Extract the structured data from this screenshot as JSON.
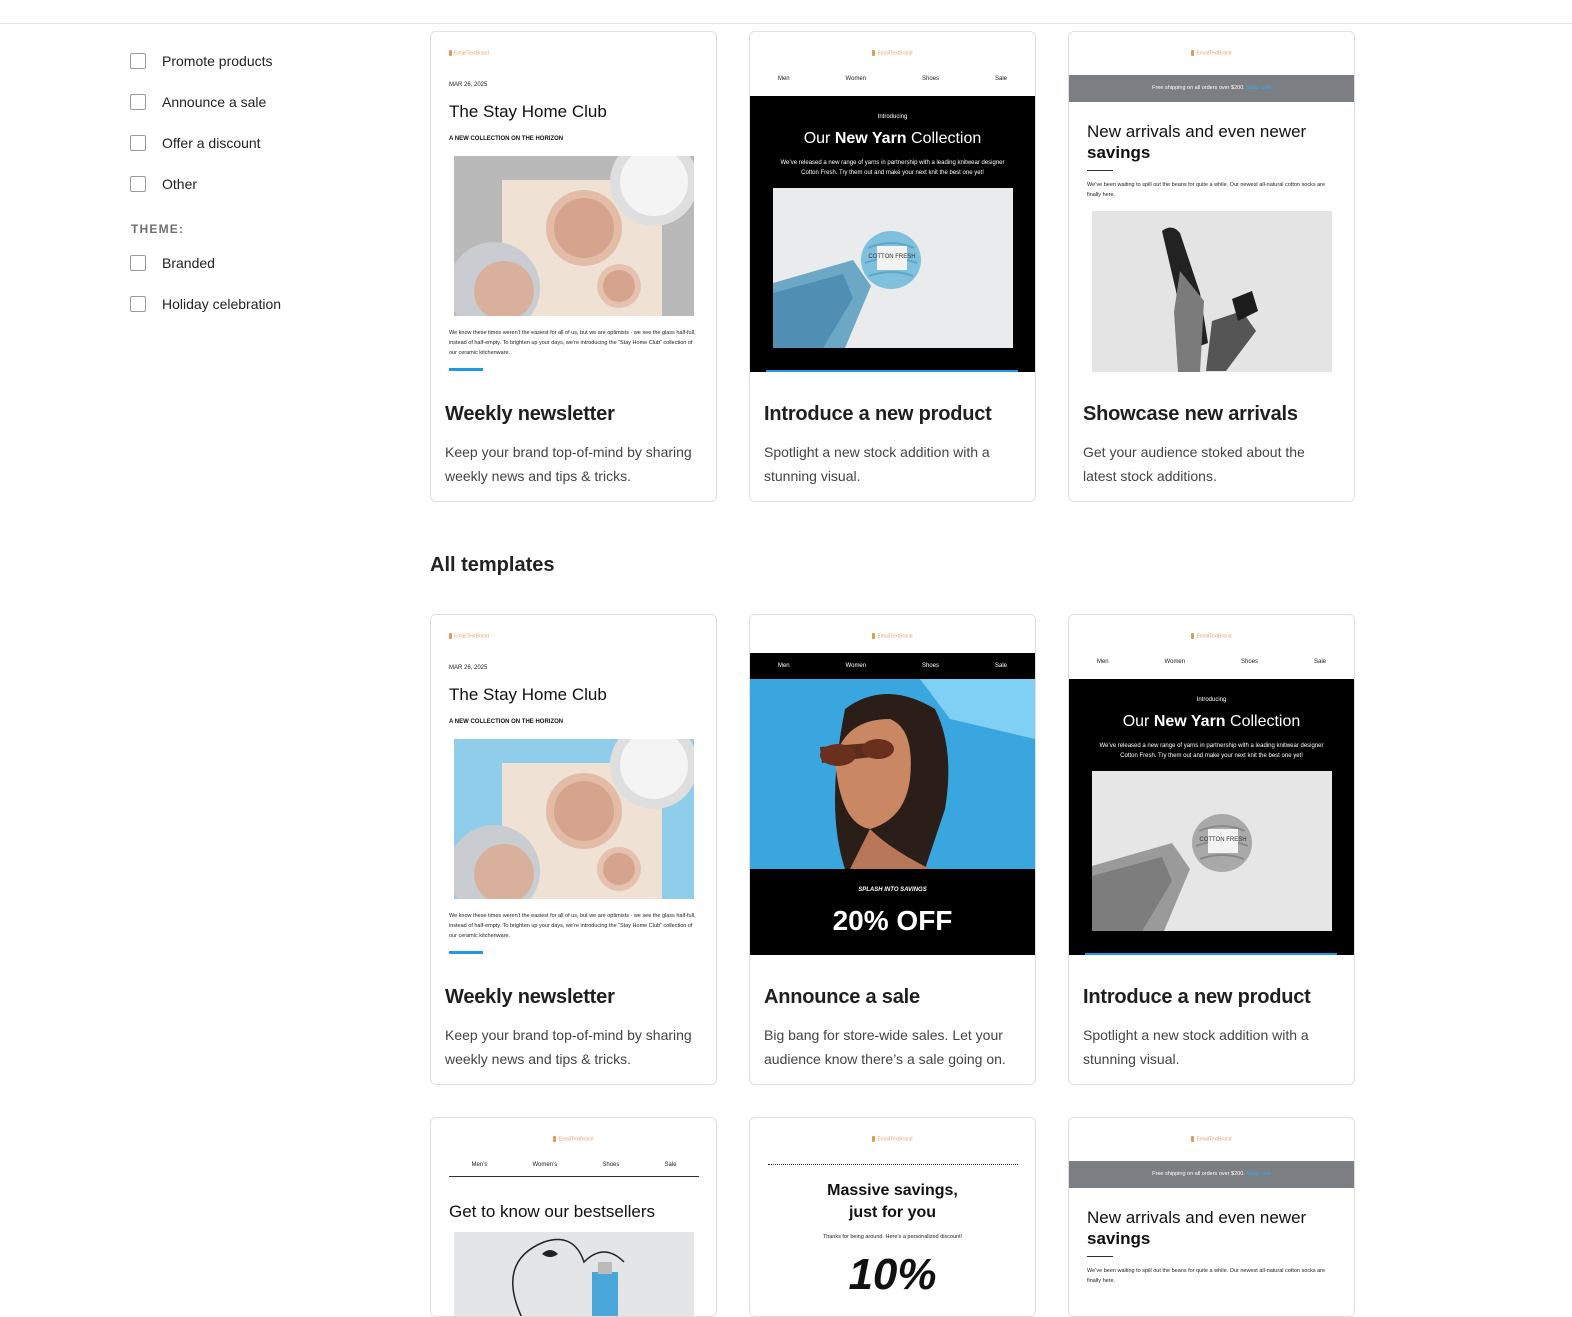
{
  "filters": {
    "goals": [
      "Promote products",
      "Announce a sale",
      "Offer a discount",
      "Other"
    ],
    "theme_heading": "THEME:",
    "themes": [
      "Branded",
      "Holiday celebration"
    ]
  },
  "section_all": "All templates",
  "templates": {
    "weekly": {
      "title": "Weekly newsletter",
      "desc": "Keep your brand top-of-mind by sharing weekly news and tips & tricks."
    },
    "product": {
      "title": "Introduce a new product",
      "desc": "Spotlight a new stock addition with a stunning visual."
    },
    "arrivals": {
      "title": "Showcase new arrivals",
      "desc": "Get your audience stoked about the latest stock additions."
    },
    "sale": {
      "title": "Announce a sale",
      "desc": "Big bang for store-wide sales. Let your audience know there’s a sale going on."
    }
  },
  "preview": {
    "logo": "EmailTextBrand",
    "newsletter": {
      "date": "MAR 26, 2025",
      "headline": "The Stay Home Club",
      "subhead": "A NEW COLLECTION ON THE HORIZON",
      "body": "We know these times weren’t the easiest for all of us, but we are optimists - we see the glass half-full, instead of half-empty. To brighten up your days, we’re introducing the “Stay Home Club” collection of our ceramic kitchenware."
    },
    "nav": [
      "Men",
      "Women",
      "Shoes",
      "Sale"
    ],
    "nav2": [
      "Men’s",
      "Women’s",
      "Shoes",
      "Sale"
    ],
    "yarn": {
      "intro": "Introducing",
      "h_a": "Our ",
      "h_b": "New Yarn",
      "h_c": " Collection",
      "text": "We’ve released a new range of yarns in partnership with a leading knitwear designer Cotton Fresh. Try them out and make your next knit the best one yet!",
      "label": "COTTON FRESH"
    },
    "ship": {
      "text": "Free shipping on all orders over $200.",
      "link": "Shop now"
    },
    "arrivals": {
      "h_a": "New arrivals and even newer",
      "h_b": "savings",
      "text": "We’ve been waiting to spill out the beans for quite a while. Our newest all-natural cotton socks are finally here."
    },
    "sale": {
      "tag": "SPLASH INTO SAVINGS",
      "pct": "20% OFF"
    },
    "best": {
      "headline": "Get to know our bestsellers"
    },
    "massive": {
      "line1": "Massive savings,",
      "line2": "just for you",
      "text": "Thanks for being around. Here’s a personalized discount!",
      "pct": "10%"
    }
  }
}
